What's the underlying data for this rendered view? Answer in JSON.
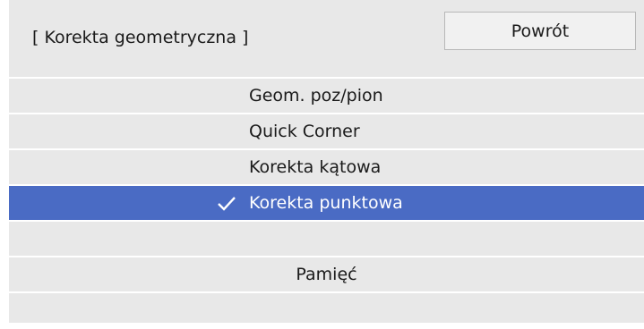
{
  "header": {
    "title": "[ Korekta geometryczna ]",
    "back_label": "Powrót"
  },
  "menu": {
    "items": [
      {
        "label": "Geom. poz/pion",
        "selected": false
      },
      {
        "label": "Quick Corner",
        "selected": false
      },
      {
        "label": "Korekta kątowa",
        "selected": false
      },
      {
        "label": "Korekta punktowa",
        "selected": true,
        "icon": "checkmark-icon"
      },
      {
        "label": "",
        "selected": false
      },
      {
        "label": "Pamięć",
        "selected": false
      },
      {
        "label": "",
        "selected": false
      }
    ]
  },
  "colors": {
    "panel": "#e8e8e8",
    "selected": "#4a6bc4",
    "selected_text": "#ffffff"
  }
}
